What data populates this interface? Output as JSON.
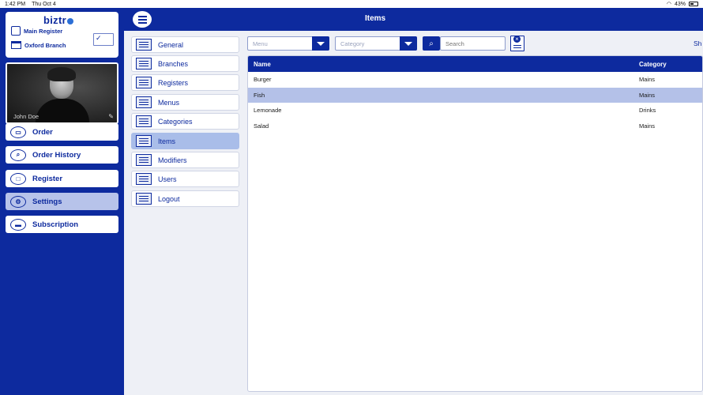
{
  "status_bar": {
    "time": "1:42 PM",
    "date": "Thu Oct 4",
    "battery": "43%"
  },
  "brand": {
    "logo": "biztr"
  },
  "register": {
    "name": "Main Register",
    "branch": "Oxford Branch"
  },
  "user": {
    "name": "John Doe"
  },
  "nav": [
    {
      "label": "Order",
      "icon": "order-icon"
    },
    {
      "label": "Order History",
      "icon": "search-icon"
    },
    {
      "label": "Register",
      "icon": "register-icon"
    },
    {
      "label": "Settings",
      "icon": "gear-icon",
      "active": true
    },
    {
      "label": "Subscription",
      "icon": "card-icon"
    }
  ],
  "header": {
    "title": "Items"
  },
  "settings_menu": [
    {
      "label": "General"
    },
    {
      "label": "Branches"
    },
    {
      "label": "Registers"
    },
    {
      "label": "Menus"
    },
    {
      "label": "Categories"
    },
    {
      "label": "Items",
      "active": true
    },
    {
      "label": "Modifiers"
    },
    {
      "label": "Users"
    },
    {
      "label": "Logout"
    }
  ],
  "filters": {
    "menu_placeholder": "Menu",
    "category_placeholder": "Category",
    "search_placeholder": "Search",
    "sh_label": "Sh"
  },
  "table": {
    "columns": [
      "Name",
      "Category"
    ],
    "rows": [
      {
        "name": "Burger",
        "category": "Mains"
      },
      {
        "name": "Fish",
        "category": "Mains",
        "selected": true
      },
      {
        "name": "Lemonade",
        "category": "Drinks"
      },
      {
        "name": "Salad",
        "category": "Mains"
      }
    ]
  },
  "colors": {
    "primary": "#0d2a9e",
    "selected_row": "#b4c1e8",
    "active_menu": "#a9bde9",
    "background": "#eef0f6"
  }
}
